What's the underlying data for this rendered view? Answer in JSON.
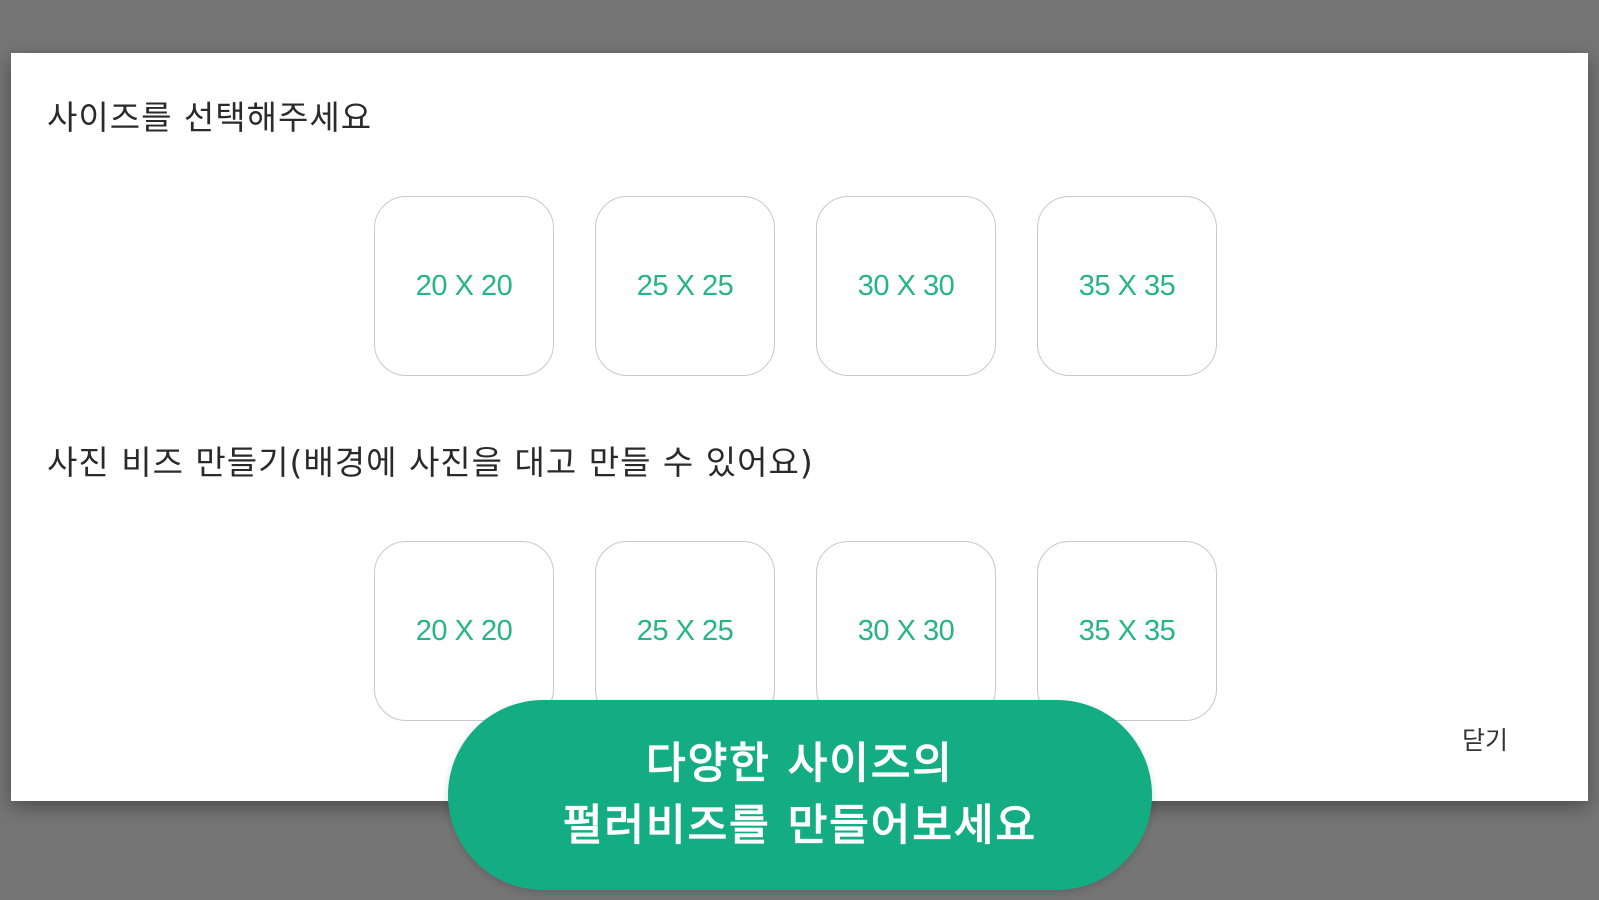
{
  "modal": {
    "sections": [
      {
        "title": "사이즈를 선택해주세요",
        "options": [
          "20 X 20",
          "25 X 25",
          "30 X 30",
          "35 X 35"
        ]
      },
      {
        "title": "사진 비즈 만들기(배경에 사진을 대고 만들 수 있어요)",
        "options": [
          "20 X 20",
          "25 X 25",
          "30 X 30",
          "35 X 35"
        ]
      }
    ],
    "close_label": "닫기"
  },
  "banner": {
    "line1": "다양한 사이즈의",
    "line2": "펄러비즈를 만들어보세요"
  },
  "colors": {
    "overlay": "#757575",
    "accent": "#27b486",
    "banner": "#14ad83"
  }
}
